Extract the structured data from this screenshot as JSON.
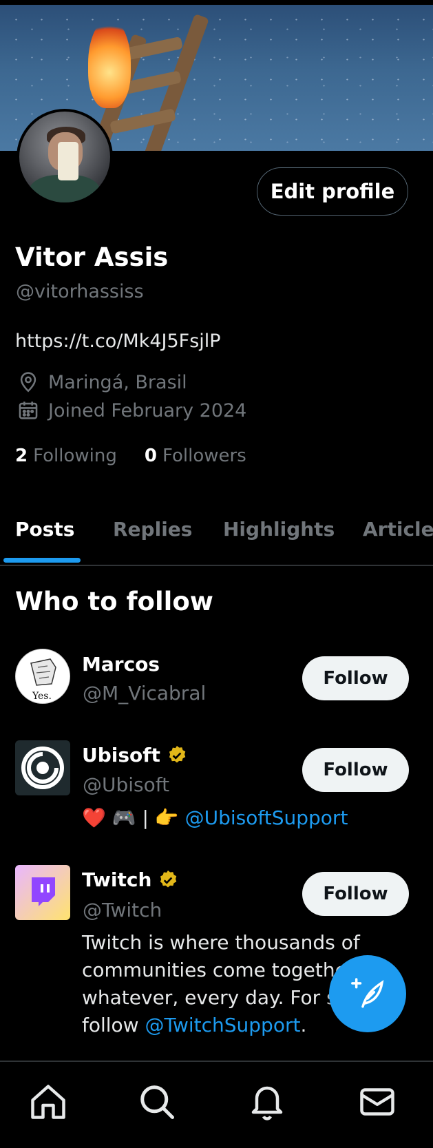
{
  "profile": {
    "name": "Vitor Assis",
    "handle": "@vitorhassiss",
    "link": "https://t.co/Mk4J5FsjlP",
    "location": "Maringá, Brasil",
    "joined": "Joined February 2024",
    "following_count": "2",
    "following_label": "Following",
    "followers_count": "0",
    "followers_label": "Followers",
    "edit_label": "Edit profile"
  },
  "tabs": [
    {
      "label": "Posts"
    },
    {
      "label": "Replies"
    },
    {
      "label": "Highlights"
    },
    {
      "label": "Articles"
    }
  ],
  "who_to_follow": {
    "title": "Who to follow",
    "follow_label": "Follow",
    "suggestions": [
      {
        "name": "Marcos",
        "handle": "@M_Vicabral",
        "avatar_text": "Yes."
      },
      {
        "name": "Ubisoft",
        "handle": "@Ubisoft",
        "bio_prefix": "❤️ 🎮 | 👉 ",
        "bio_mention": "@UbisoftSupport"
      },
      {
        "name": "Twitch",
        "handle": "@Twitch",
        "bio_line1": "Twitch is where thousands of",
        "bio_line2": "communities come together",
        "bio_line3": "whatever, every day. For site",
        "bio_line4_prefix": "follow ",
        "bio_mention": "@TwitchSupport",
        "bio_line4_suffix": "."
      }
    ]
  },
  "colors": {
    "accent": "#1d9bf0",
    "verified": "#e2b719",
    "background": "#000000",
    "muted_text": "#71767b"
  },
  "icons": [
    "location-icon",
    "calendar-icon",
    "verified-icon",
    "compose-icon",
    "home-icon",
    "search-icon",
    "notifications-icon",
    "messages-icon"
  ]
}
